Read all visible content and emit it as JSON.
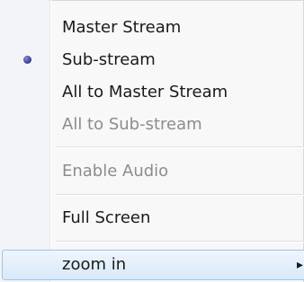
{
  "context_menu": {
    "items": [
      {
        "label": "Master Stream",
        "enabled": true,
        "checked": false
      },
      {
        "label": "Sub-stream",
        "enabled": true,
        "checked": true
      },
      {
        "label": "All to Master Stream",
        "enabled": true,
        "checked": false
      },
      {
        "label": "All to Sub-stream",
        "enabled": false,
        "checked": false
      },
      {
        "label": "Enable Audio",
        "enabled": false,
        "checked": false
      },
      {
        "label": "Full Screen",
        "enabled": true,
        "checked": false
      },
      {
        "label": "zoom in",
        "enabled": true,
        "checked": false,
        "has_submenu": true,
        "highlighted": true
      }
    ],
    "checked_icon": "radio-bullet-icon",
    "submenu_icon": "submenu-arrow-icon"
  },
  "colors": {
    "menu_background": "#f8f8f8",
    "gutter_background": "#f3f4f7",
    "disabled_text": "#8c8c8c",
    "highlight_border": "#9fc3e8",
    "highlight_fill": "#d9e9f9",
    "bullet": "#3e3f9a"
  }
}
